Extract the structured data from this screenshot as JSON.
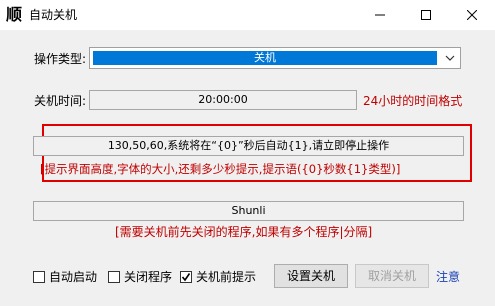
{
  "window": {
    "app_icon_char": "顺",
    "title": "自动关机",
    "controls": [
      "minimize-icon",
      "maximize-icon",
      "close-icon"
    ]
  },
  "operation": {
    "label": "操作类型:",
    "selected": "关机"
  },
  "shutdown_time": {
    "label": "关机时间:",
    "value": "20:00:00",
    "hint": "24小时的时间格式"
  },
  "prompt": {
    "value": "130,50,60,系统将在“{0}”秒后自动{1},请立即停止操作",
    "hint": "[提示界面高度,字体的大小,还剩多少秒提示,提示语({0}秒数{1}类型)]"
  },
  "programs": {
    "value": "Shunli",
    "hint": "[需要关机前先关闭的程序,如果有多个程序|分隔]"
  },
  "options": {
    "autostart": {
      "label": "自动启动",
      "checked": false
    },
    "close_program": {
      "label": "关闭程序",
      "checked": false
    },
    "pre_notice": {
      "label": "关机前提示",
      "checked": true
    }
  },
  "buttons": {
    "set": "设置关机",
    "cancel": "取消关机"
  },
  "note_link": "注意",
  "colors": {
    "accent": "#0078d7",
    "hint_red": "#c00000",
    "highlight_border": "#e00000"
  }
}
